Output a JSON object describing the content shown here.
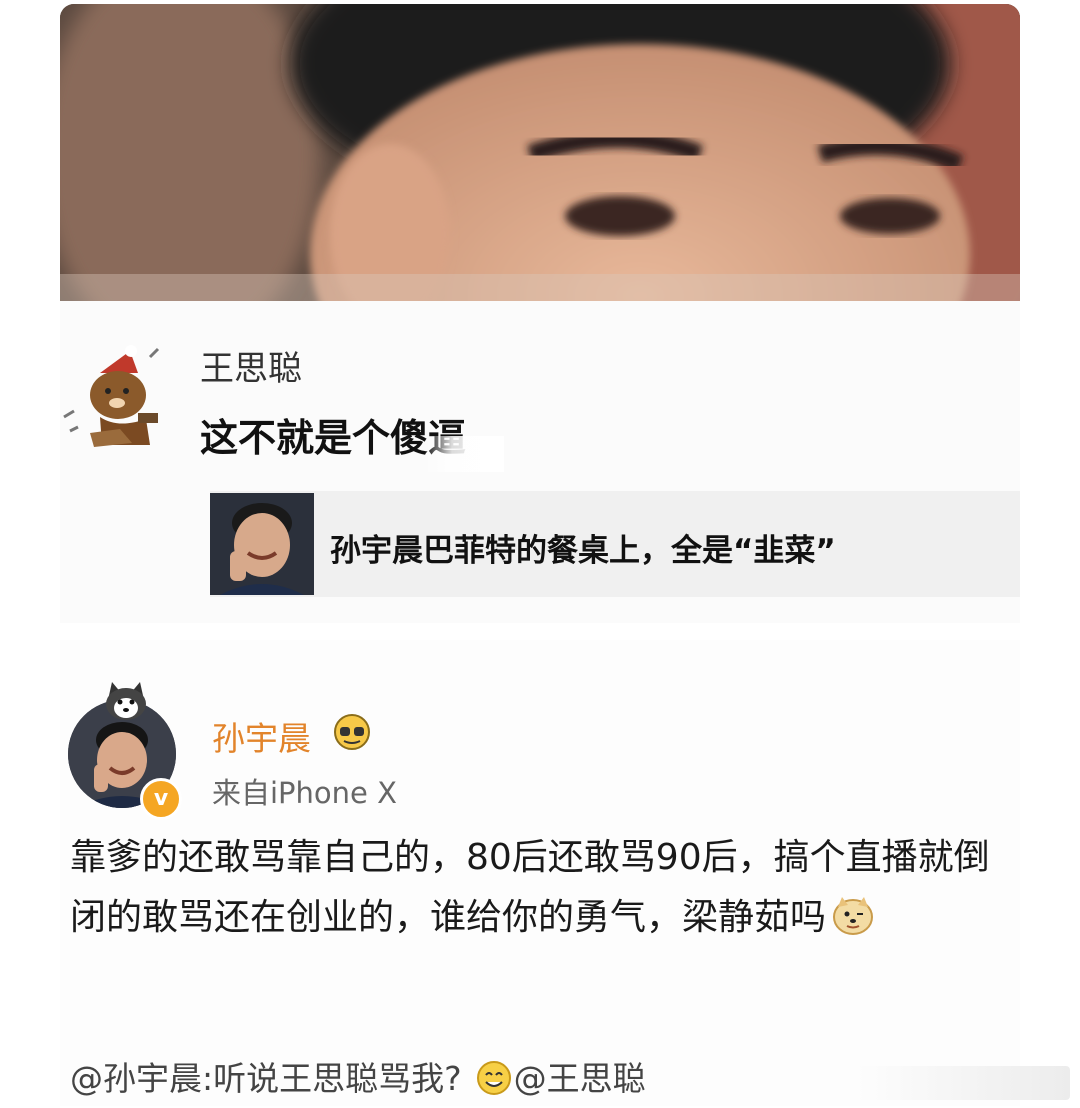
{
  "comment": {
    "author": "王思聪",
    "text": "这不就是个傻逼",
    "shared_post": {
      "title": "孙宇晨巴菲特的餐桌上，全是“韭菜”"
    }
  },
  "post": {
    "author": "孙宇晨",
    "source": "来自iPhone X",
    "verified_mark": "v",
    "body": "靠爹的还敢骂靠自己的，80后还敢骂90后，搞个直播就倒闭的敢骂还在创业的，谁给你的勇气，梁静茹吗",
    "repost_prefix": "@孙宇晨:听说王思聪骂我?",
    "repost_mention": "@王思聪"
  },
  "icons": {
    "commenter_avatar": "cartoon-bear-sticker-icon",
    "badge": "emoji-badge-icon",
    "dog_emoji": "doge-emoji-icon",
    "repost_emoji": "smile-emoji-icon"
  },
  "colors": {
    "author_name": "#e2842b",
    "verified": "#f5a623"
  }
}
